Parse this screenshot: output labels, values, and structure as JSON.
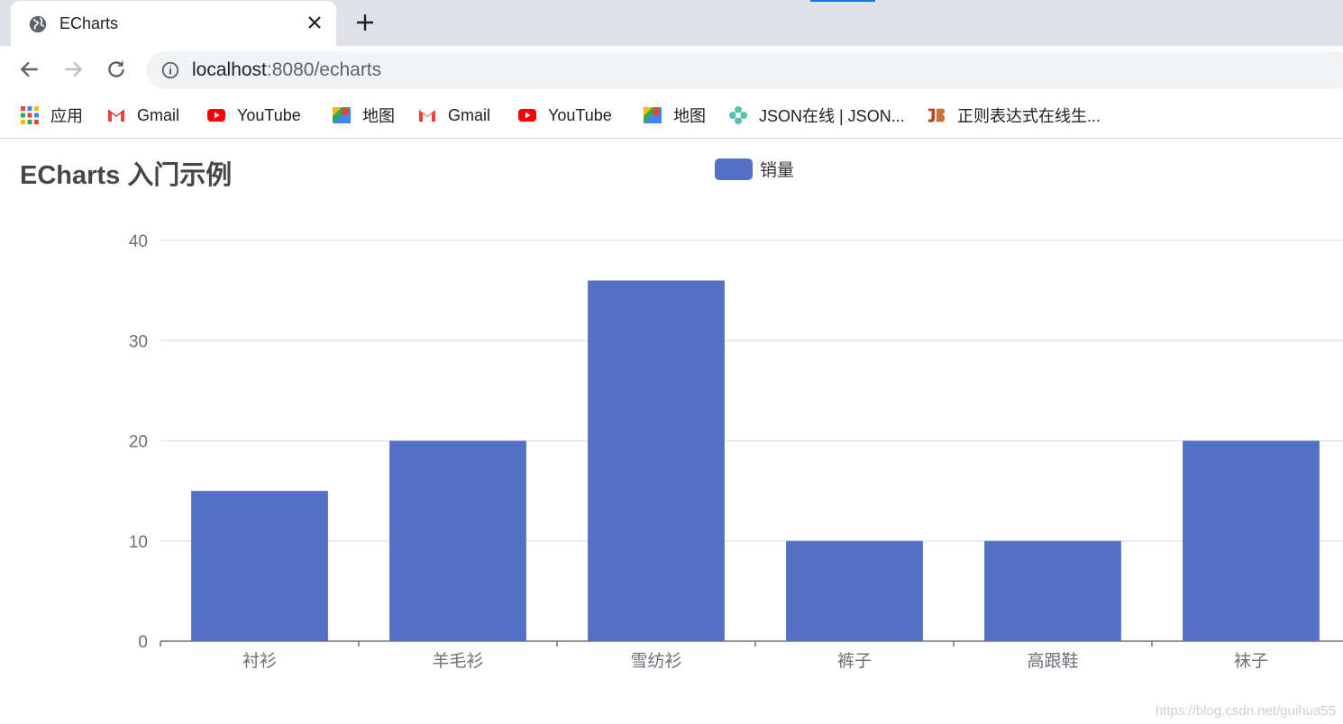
{
  "browser": {
    "tab": {
      "title": "ECharts",
      "icon": "globe-icon"
    },
    "address": {
      "host": "localhost",
      "rest": ":8080/echarts"
    },
    "bookmarks": [
      {
        "label": "应用",
        "icon": "apps-grid-icon"
      },
      {
        "label": "Gmail",
        "icon": "gmail-icon"
      },
      {
        "label": "YouTube",
        "icon": "youtube-icon"
      },
      {
        "label": "地图",
        "icon": "maps-icon"
      },
      {
        "label": "Gmail",
        "icon": "gmail-icon"
      },
      {
        "label": "YouTube",
        "icon": "youtube-icon"
      },
      {
        "label": "地图",
        "icon": "maps-icon"
      },
      {
        "label": "JSON在线 | JSON...",
        "icon": "json-flower-icon"
      },
      {
        "label": "正则表达式在线生...",
        "icon": "jb-logo-icon"
      }
    ]
  },
  "colors": {
    "bar": "#5470c6",
    "axis": "#6e7079",
    "grid": "#e0e6f1",
    "label": "#6e7079"
  },
  "chart_data": {
    "type": "bar",
    "title": "ECharts 入门示例",
    "legend": [
      "销量"
    ],
    "legend_position": "top-center",
    "categories": [
      "衬衫",
      "羊毛衫",
      "雪纺衫",
      "裤子",
      "高跟鞋",
      "袜子"
    ],
    "series": [
      {
        "name": "销量",
        "values": [
          15,
          20,
          36,
          10,
          10,
          20
        ]
      }
    ],
    "yticks": [
      0,
      10,
      20,
      30,
      40
    ],
    "ylim": [
      0,
      40
    ],
    "grid": true
  },
  "watermark": "https://blog.csdn.net/guihua55"
}
